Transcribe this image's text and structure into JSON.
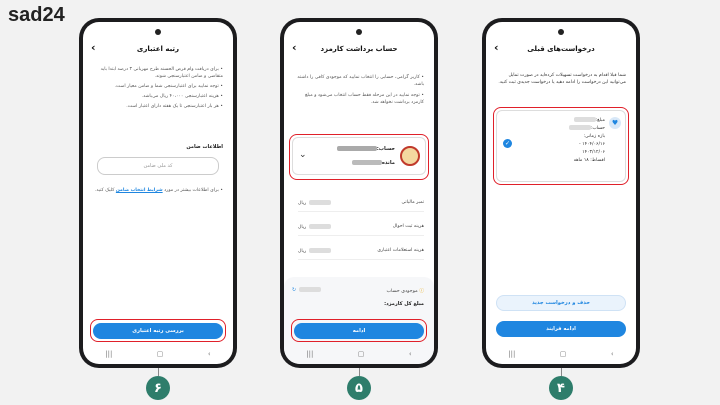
{
  "brand": "sad24",
  "phone_left": {
    "title": "رتبه اعتباری",
    "bullets": [
      "• برای دریافت وام قرض الحسنه طرح مهربانی ۳ درصد ابتدا باید متقاضی و ضامن اعتبارسنجی شوند.",
      "• توجه نمایید برای اعتبارسنجی شما و ضامن معیار است.",
      "• هزینه اعتبارسنجی ۴۰،۰۰۰ ریال می‌باشد.",
      "• هر بار اعتبارسنجی تا یک هفته دارای اعتبار است."
    ],
    "guarantor_heading": "اطلاعات ضامن",
    "guarantor_placeholder": "کد ملی ضامن",
    "info_text": "• برای اطلاعات بیشتر در مورد",
    "info_link": "شرایط انتخاب ضامن",
    "info_suffix": "کلیک کنید.",
    "button": "بررسی رتبه اعتباری"
  },
  "phone_mid": {
    "title": "حساب برداشت کارمزد",
    "bullets": [
      "• کاربر گرامی، حسابی را انتخاب نمایید که موجودی کافی را داشته باشد.",
      "• توجه نمایید در این مرحله فقط حساب انتخاب می‌شود و مبلغ کارمزد برداشت نخواهد شد."
    ],
    "account_label": "حساب:",
    "balance_label": "مانده",
    "rows": [
      {
        "label": "تمبر مالیاتی",
        "value": "ریال"
      },
      {
        "label": "هزینه ثبت احوال",
        "value": "ریال"
      },
      {
        "label": "هزینه استعلامات اعتباری",
        "value": "ریال"
      }
    ],
    "balance_section": "موجودی حساب",
    "total_fee": "مبلغ کل کارمزد:",
    "button": "ادامه"
  },
  "phone_right": {
    "title": "درخواست‌های قبلی",
    "intro": "شما قبلا اقدام به درخواست تسهیلات کرده‌اید در صورت تمایل می‌توانید این درخواست را ادامه دهید یا درخواست جدیدی ثبت کنید.",
    "amount_label": "مبلغ:",
    "account_label": "حساب:",
    "period_label": "بازه زمانی:",
    "date_from": "۱۴۰۴/۰۶/۱۶ -",
    "date_to": "۱۴۰۳/۱۲/۰۶",
    "installments": "اقساط: ۱۸ ماهه",
    "delete_button": "حذف و درخواست جدید",
    "continue_button": "ادامه فرایند"
  },
  "steps": [
    "۶",
    "۵",
    "۴"
  ],
  "nav_icons": [
    "recent-apps-icon",
    "home-icon",
    "back-icon"
  ]
}
